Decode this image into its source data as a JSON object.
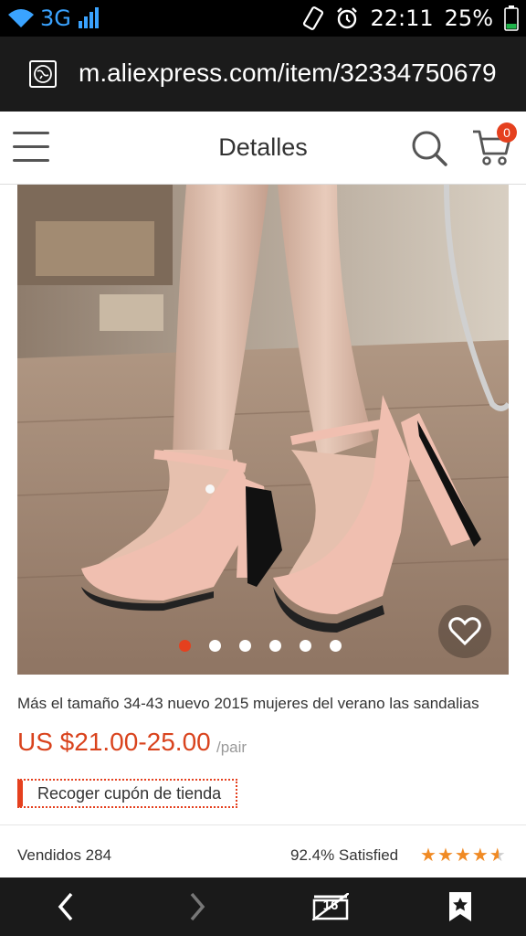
{
  "status_bar": {
    "network": "3G",
    "time": "22:11",
    "battery": "25%"
  },
  "browser": {
    "url": "m.aliexpress.com/item/32334750679"
  },
  "appbar": {
    "title": "Detalles",
    "cart_count": "0"
  },
  "product": {
    "title": "Más el tamaño 34-43 nuevo 2015 mujeres del verano las sandalias",
    "price": "US $21.00-25.00",
    "unit": "/pair",
    "coupon_label": "Recoger cupón de tienda",
    "sold": "Vendidos 284",
    "satisfied": "92.4% Satisfied",
    "rating_stars": 4.5,
    "gallery_index": 1,
    "gallery_count": 6
  },
  "bottom_nav": {
    "tabs_count": "16"
  },
  "colors": {
    "accent": "#e5401e",
    "price": "#d9431d",
    "star": "#f08a24"
  }
}
